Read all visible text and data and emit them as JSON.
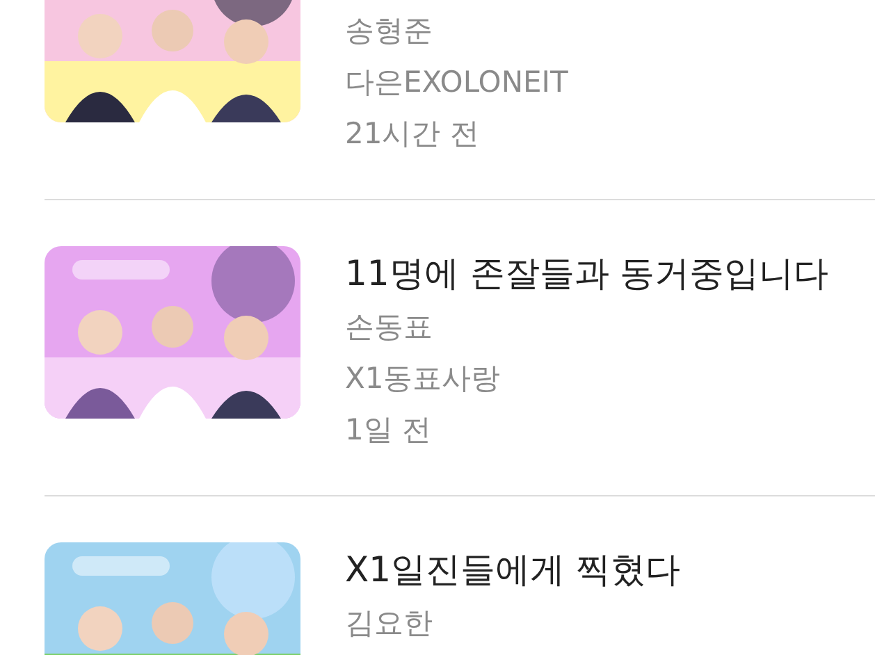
{
  "videos": [
    {
      "channel": "송형준",
      "uploader": "다은EXOLONEIT",
      "time": "21시간 전"
    },
    {
      "title": "11명에 존잘들과 동거중입니다",
      "channel": "손동표",
      "uploader": "X1동표사랑",
      "time": "1일 전"
    },
    {
      "title": "X1일진들에게 찍혔다",
      "channel": "김요한"
    }
  ]
}
